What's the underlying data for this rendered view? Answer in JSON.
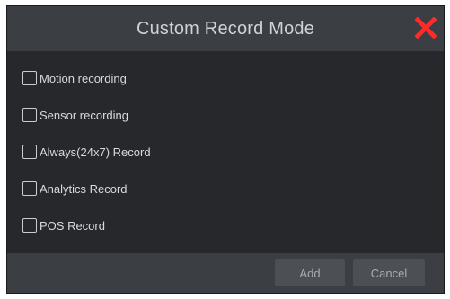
{
  "dialog": {
    "title": "Custom Record Mode",
    "close_icon": "close-icon",
    "close_color": "#ff2b2b"
  },
  "options": [
    {
      "label": "Motion recording",
      "checked": false
    },
    {
      "label": "Sensor recording",
      "checked": false
    },
    {
      "label": "Always(24x7) Record",
      "checked": false
    },
    {
      "label": "Analytics Record",
      "checked": false
    },
    {
      "label": "POS Record",
      "checked": false
    }
  ],
  "footer": {
    "add_label": "Add",
    "cancel_label": "Cancel"
  }
}
